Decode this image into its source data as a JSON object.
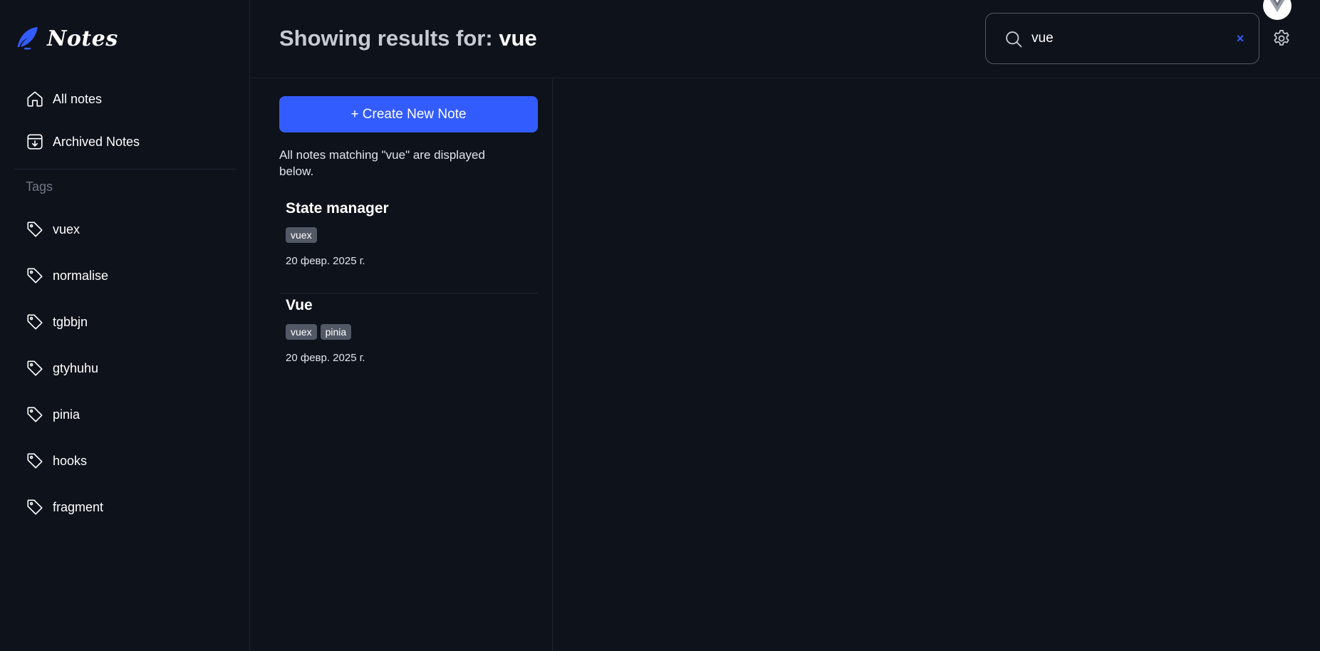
{
  "app": {
    "logo_text": "Notes"
  },
  "sidebar": {
    "nav": [
      {
        "label": "All notes",
        "icon": "home-icon"
      },
      {
        "label": "Archived Notes",
        "icon": "archive-icon"
      }
    ],
    "tags_title": "Tags",
    "tags": [
      "vuex",
      "normalise",
      "tgbbjn",
      "gtyhuhu",
      "pinia",
      "hooks",
      "fragment"
    ]
  },
  "header": {
    "title_prefix": "Showing results for:",
    "query": "vue",
    "search": {
      "value": "vue",
      "clear": "×"
    }
  },
  "list": {
    "create_label": "+ Create New Note",
    "message": "All notes matching \"vue\" are displayed below.",
    "notes": [
      {
        "title": "State manager",
        "tags": [
          "vuex"
        ],
        "date": "20 февр. 2025 г."
      },
      {
        "title": "Vue",
        "tags": [
          "vuex",
          "pinia"
        ],
        "date": "20 февр. 2025 г."
      }
    ]
  },
  "colors": {
    "background": "#0e121b",
    "accent": "#335cff",
    "tag_bg": "#525866",
    "muted_text": "#717784"
  }
}
